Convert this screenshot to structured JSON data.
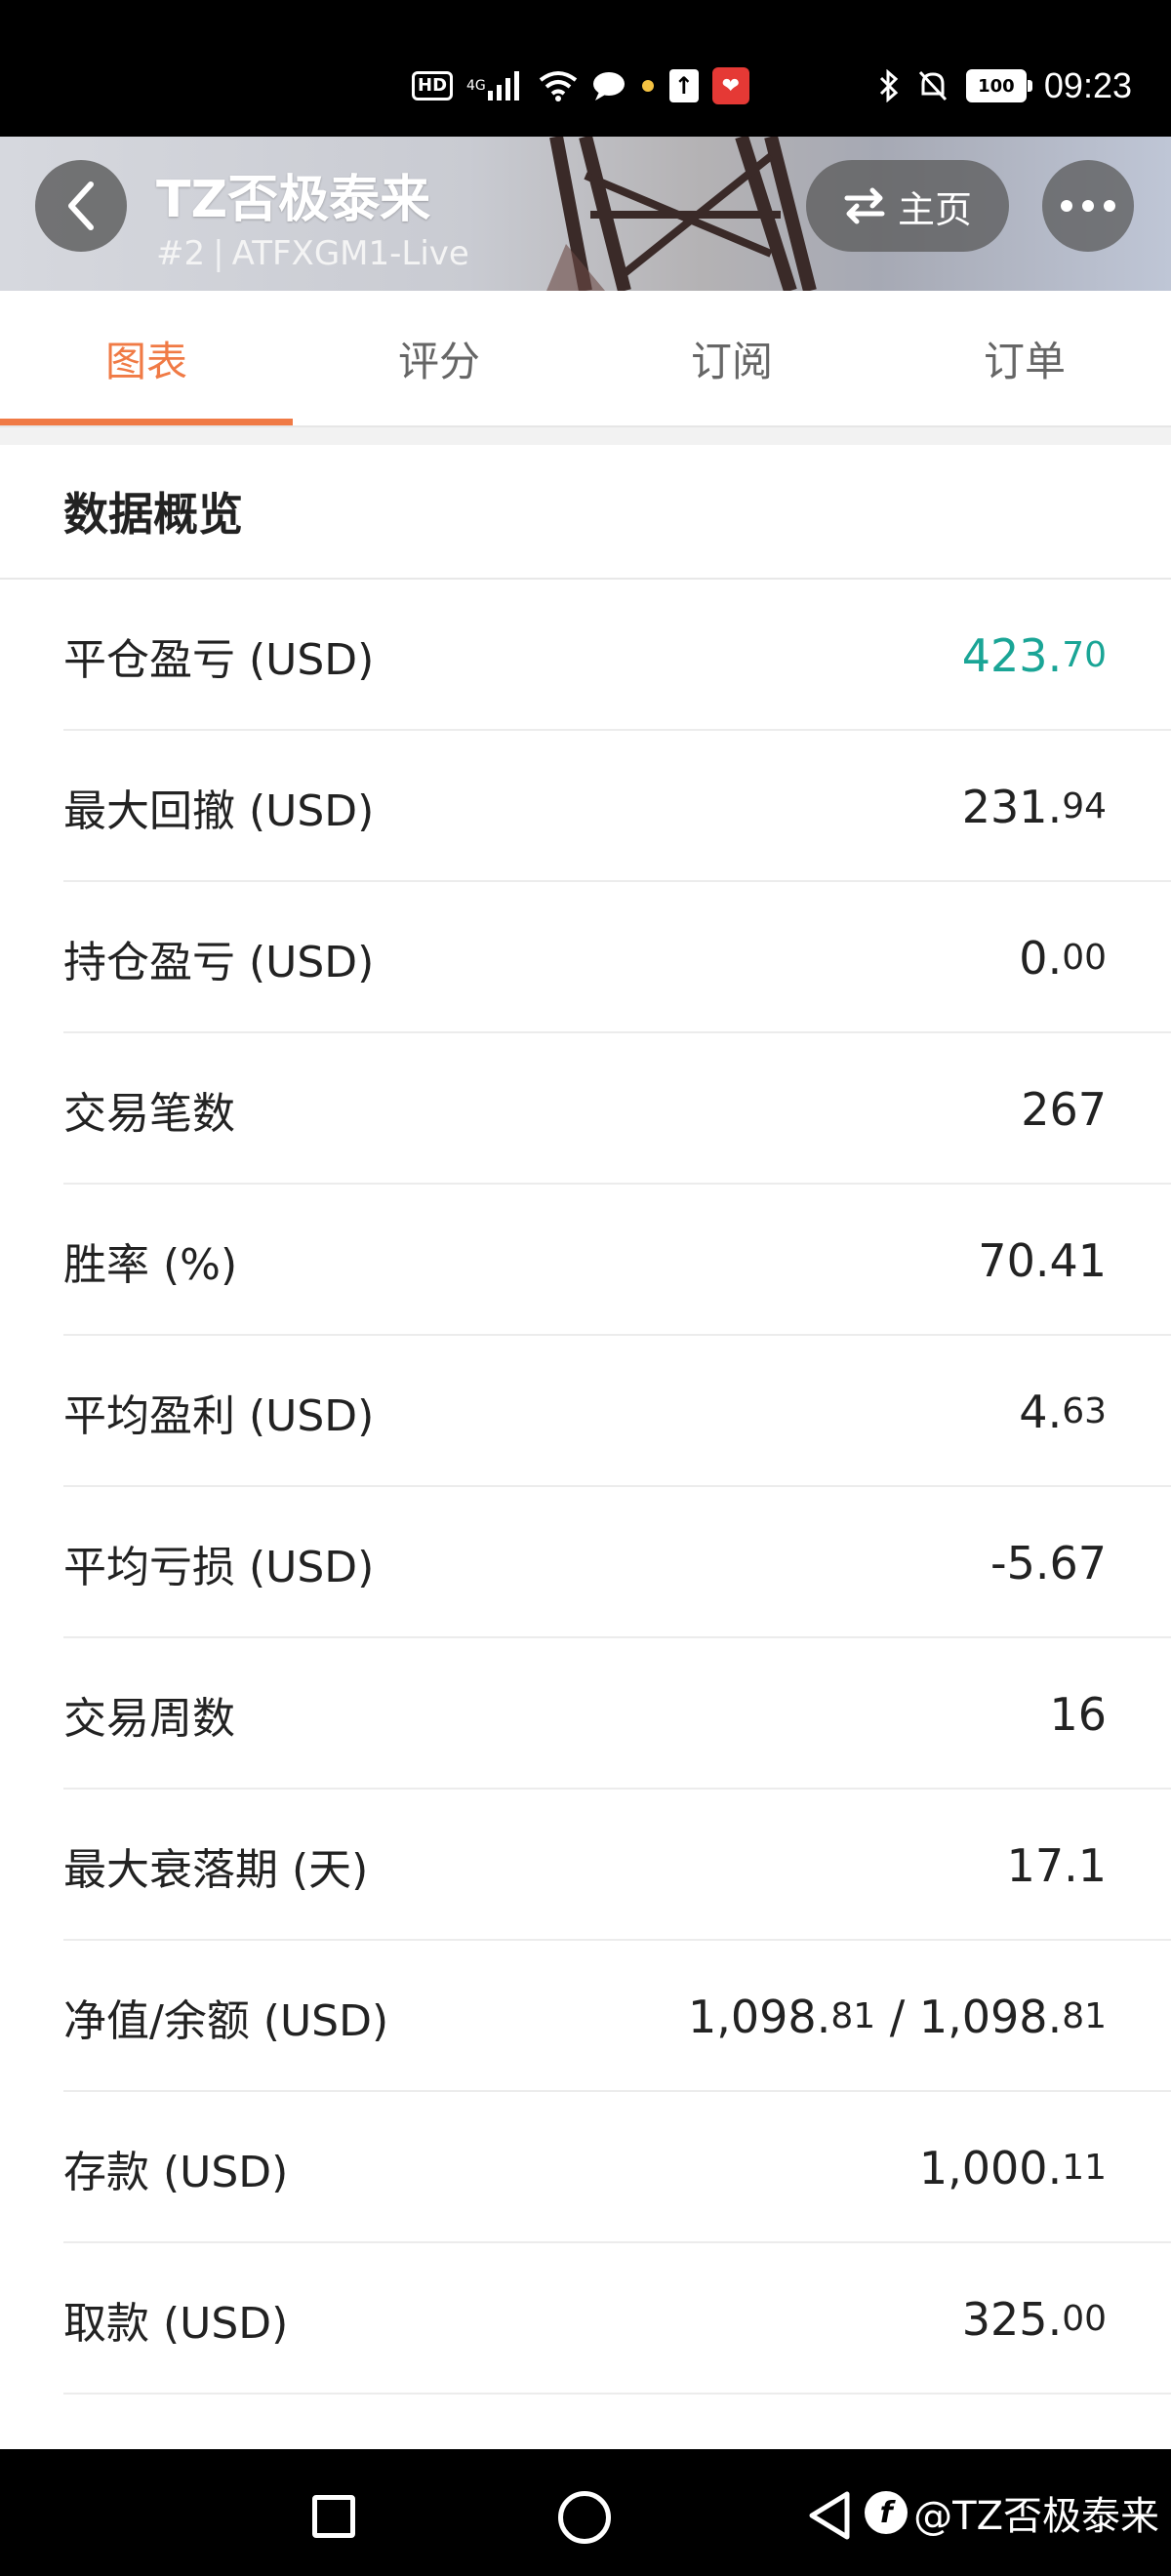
{
  "status_bar": {
    "hd": "HD",
    "network": "4G",
    "battery": "100",
    "time": "09:23"
  },
  "header": {
    "title": "TZ否极泰来",
    "rank": "#2",
    "account": "ATFXGM1-Live",
    "home_label": "主页"
  },
  "tabs": [
    {
      "label": "图表",
      "active": true
    },
    {
      "label": "评分",
      "active": false
    },
    {
      "label": "订阅",
      "active": false
    },
    {
      "label": "订单",
      "active": false
    }
  ],
  "section_title": "数据概览",
  "rows": [
    {
      "label": "平仓盈亏 (USD)",
      "value_main": "423.",
      "value_dec": "70",
      "color": "#1aa596"
    },
    {
      "label": "最大回撤 (USD)",
      "value_main": "231.",
      "value_dec": "94"
    },
    {
      "label": "持仓盈亏 (USD)",
      "value_main": "0.",
      "value_dec": "00"
    },
    {
      "label": "交易笔数",
      "value_main": "267",
      "value_dec": ""
    },
    {
      "label": "胜率 (%)",
      "value_main": "70.41",
      "value_dec": ""
    },
    {
      "label": "平均盈利 (USD)",
      "value_main": "4.",
      "value_dec": "63"
    },
    {
      "label": "平均亏损 (USD)",
      "value_main": "-5.67",
      "value_dec": ""
    },
    {
      "label": "交易周数",
      "value_main": "16",
      "value_dec": ""
    },
    {
      "label": "最大衰落期 (天)",
      "value_main": "17.1",
      "value_dec": ""
    },
    {
      "label": "净值/余额 (USD)",
      "value_main": "1,098.",
      "value_dec": "81",
      "value_mid": " / ",
      "value_main2": "1,098.",
      "value_dec2": "81"
    },
    {
      "label": "存款 (USD)",
      "value_main": "1,000.",
      "value_dec": "11"
    },
    {
      "label": "取款 (USD)",
      "value_main": "325.",
      "value_dec": "00"
    }
  ],
  "watermark": "@TZ否极泰来",
  "colors": {
    "accent": "#f07a45",
    "positive": "#1aa596"
  }
}
